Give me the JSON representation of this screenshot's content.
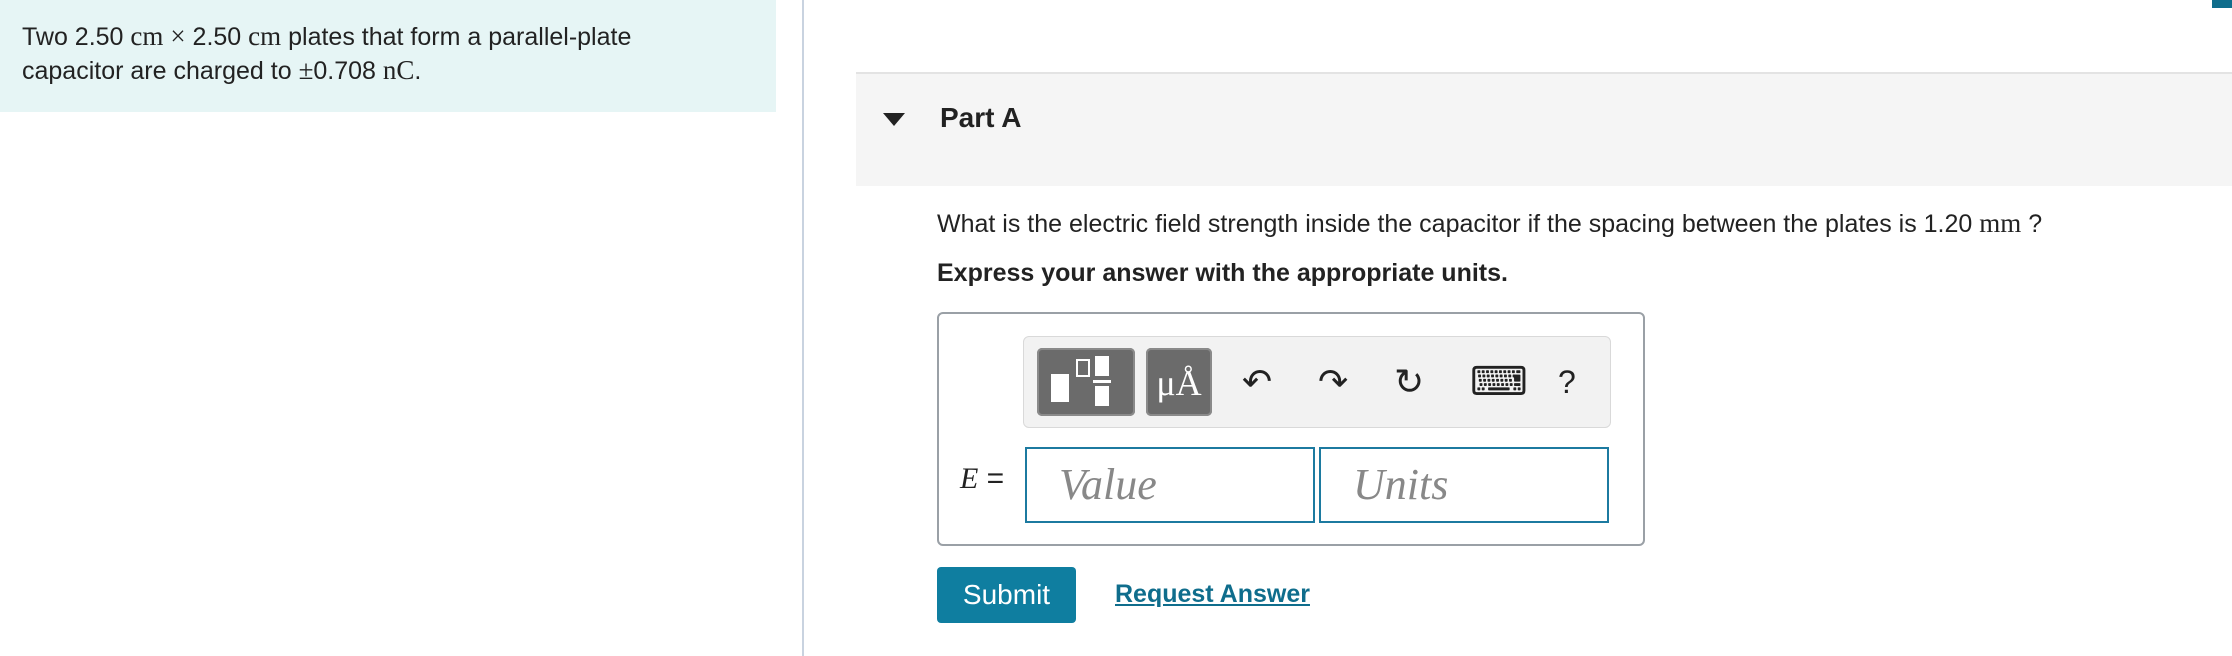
{
  "problem": {
    "t1": "Two 2.50",
    "u1": "cm",
    "times": "×",
    "t2": "2.50",
    "u2": "cm",
    "t3": "plates that form a parallel-plate",
    "t4": "capacitor are charged to",
    "pm": "±",
    "t5": "0.708",
    "u3": "nC",
    "t6": "."
  },
  "part": {
    "title": "Part A",
    "question_text": "What is the electric field strength inside the capacitor if the spacing between the plates is 1.20",
    "question_unit": "mm",
    "question_end": "?",
    "instruction": "Express your answer with the appropriate units."
  },
  "toolbar": {
    "units_label": "μÅ",
    "undo_glyph": "↶",
    "redo_glyph": "↷",
    "reset_glyph": "↻",
    "keyboard_glyph": "⌨",
    "help_glyph": "?"
  },
  "answer": {
    "var": "E",
    "eq": "=",
    "value_placeholder": "Value",
    "units_placeholder": "Units"
  },
  "actions": {
    "submit_label": "Submit",
    "request_label": "Request Answer"
  },
  "colors": {
    "accent": "#0f7ea0",
    "problem_bg": "#e6f5f5"
  }
}
